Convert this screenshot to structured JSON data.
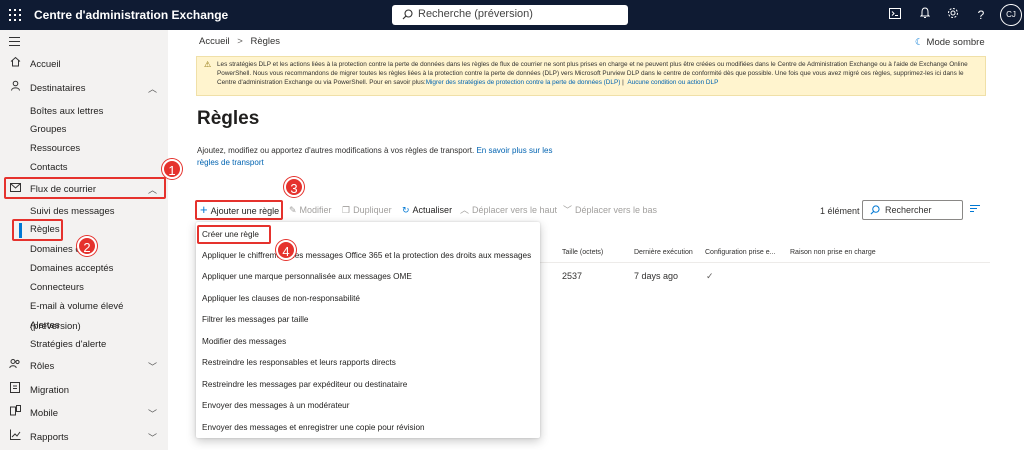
{
  "app": {
    "title": "Centre d'administration Exchange",
    "avatar": "CJ"
  },
  "search": {
    "placeholder": "Recherche (préversion)"
  },
  "sidebar": {
    "items": [
      {
        "label": "Accueil"
      },
      {
        "label": "Destinataires"
      },
      {
        "label": "Boîtes aux lettres"
      },
      {
        "label": "Groupes"
      },
      {
        "label": "Ressources"
      },
      {
        "label": "Contacts"
      },
      {
        "label": "Flux de courrier"
      },
      {
        "label": "Suivi des messages"
      },
      {
        "label": "Règles"
      },
      {
        "label": "Domaines di"
      },
      {
        "label": "Domaines acceptés"
      },
      {
        "label": "Connecteurs"
      },
      {
        "label": "E-mail à volume élevé (préversion)"
      },
      {
        "label": "Alertes"
      },
      {
        "label": "Stratégies d'alerte"
      },
      {
        "label": "Rôles"
      },
      {
        "label": "Migration"
      },
      {
        "label": "Mobile"
      },
      {
        "label": "Rapports"
      }
    ]
  },
  "breadcrumb": {
    "root": "Accueil",
    "sep": ">",
    "current": "Règles"
  },
  "dark_mode": "Mode sombre",
  "banner": {
    "text": "Les stratégies DLP et les actions liées à la protection contre la perte de données dans les règles de flux de courrier ne sont plus prises en charge et ne peuvent plus être créées ou modifiées dans le Centre de Administration Exchange ou à l'aide de Exchange Online PowerShell. Nous vous recommandons de migrer toutes les règles liées à la protection contre la perte de données (DLP) vers Microsoft Purview DLP dans le centre de conformité dès que possible. Une fois que vous avez migré ces règles, supprimez-les ici dans le Centre d'administration Exchange ou via PowerShell. Pour en savoir plus:",
    "link1": "Migrer des stratégies de protection contre la perte de données (DLP)",
    "sep": "|",
    "link2": "Aucune condition ou action DLP"
  },
  "page": {
    "title": "Règles",
    "description": "Ajoutez, modifiez ou apportez d'autres modifications à vos règles de transport.",
    "link": "En savoir plus sur les règles de transport"
  },
  "toolbar": {
    "add": "Ajouter une règle",
    "edit": "Modifier",
    "duplicate": "Dupliquer",
    "refresh": "Actualiser",
    "move_up": "Déplacer vers le haut",
    "move_down": "Déplacer vers le bas",
    "count": "1 élément",
    "search": "Rechercher"
  },
  "table": {
    "headers": [
      "Taille (octets)",
      "Dernière exécution",
      "Configuration prise e...",
      "Raison non prise en charge"
    ],
    "row": {
      "size": "2537",
      "last_run": "7 days ago",
      "config": "✓"
    }
  },
  "menu": {
    "items": [
      "Créer une règle",
      "Appliquer le chiffrement des messages Office 365 et la protection des droits aux messages",
      "Appliquer une marque personnalisée aux messages OME",
      "Appliquer les clauses de non-responsabilité",
      "Filtrer les messages par taille",
      "Modifier des messages",
      "Restreindre les responsables et leurs rapports directs",
      "Restreindre les messages par expéditeur ou destinataire",
      "Envoyer des messages à un modérateur",
      "Envoyer des messages et enregistrer une copie pour révision"
    ]
  },
  "callouts": [
    "1",
    "2",
    "3",
    "4"
  ],
  "colors": {
    "topbar": "#0f1b33",
    "accent": "#0078d4",
    "callout": "#e5322d",
    "banner": "#fff4ce"
  }
}
